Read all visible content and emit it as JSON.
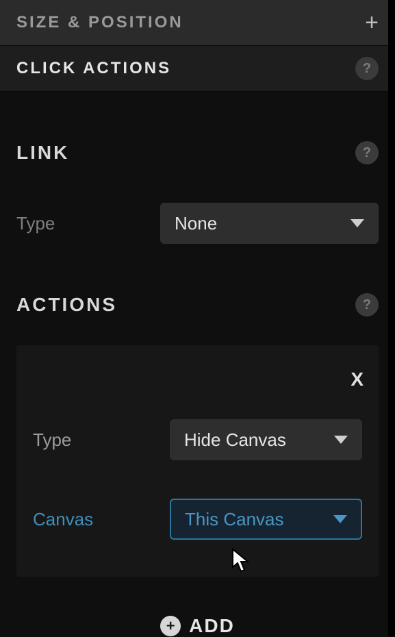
{
  "sections": {
    "size_position": {
      "title": "SIZE & POSITION"
    },
    "click_actions": {
      "title": "CLICK ACTIONS"
    }
  },
  "link": {
    "heading": "LINK",
    "type_label": "Type",
    "type_value": "None"
  },
  "actions": {
    "heading": "ACTIONS",
    "card": {
      "close": "X",
      "type_label": "Type",
      "type_value": "Hide Canvas",
      "canvas_label": "Canvas",
      "canvas_value": "This Canvas"
    },
    "add_label": "ADD"
  },
  "icons": {
    "plus": "+",
    "help": "?",
    "add_plus": "+"
  }
}
